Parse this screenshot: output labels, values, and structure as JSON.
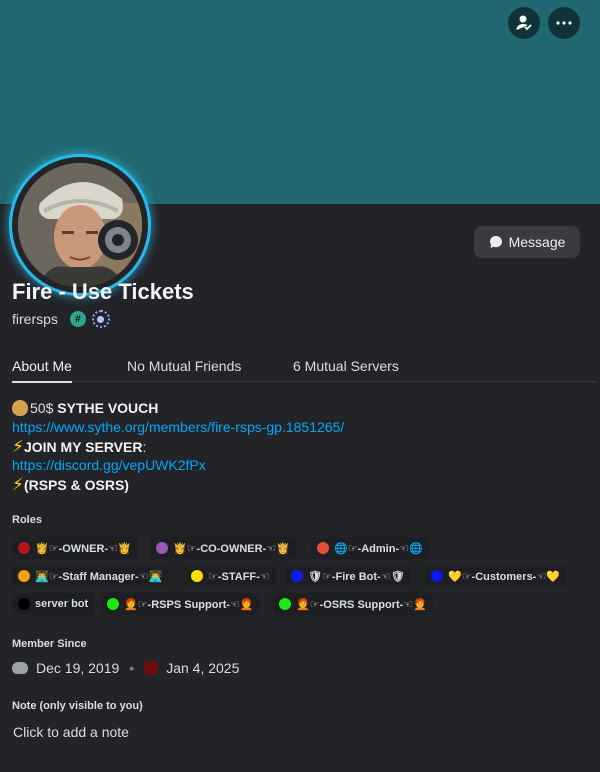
{
  "header": {
    "banner_color": "#216870",
    "add_friend_icon": "add-friend-icon",
    "more_icon": "more-options-icon"
  },
  "profile": {
    "display_name": "Fire - Use Tickets",
    "username": "firersps",
    "badge_hash": "#",
    "status": "offline",
    "message_button": "Message"
  },
  "tabs": [
    "About Me",
    "No Mutual Friends",
    "6 Mutual Servers"
  ],
  "about": {
    "line1_amount": "50$",
    "line1_text": "SYTHE VOUCH",
    "line2_link": "https://www.sythe.org/members/fire-rsps-gp.1851265/",
    "line3_text": "JOIN MY SERVER",
    "line3_colon": ":",
    "line4_link": "https://discord.gg/vepUWK2fPx",
    "line5_text": "(RSPS & OSRS)"
  },
  "roles_title": "Roles",
  "roles": [
    {
      "name": "👸☞-OWNER-☜👸",
      "color": "#b3171d"
    },
    {
      "name": "👸☞-CO-OWNER-☜👸",
      "color": "#9b59b6"
    },
    {
      "name": "🌐☞-Admin-☜🌐",
      "color": "#e74c3c"
    },
    {
      "name": "👨‍💻☞-Staff Manager-☜👨‍💻",
      "color": "#f1a30f"
    },
    {
      "name": "☞-STAFF-☜",
      "color": "#ffe000"
    },
    {
      "name": "🛡☞-Fire Bot-☜🛡",
      "color": "#0b1cf0"
    },
    {
      "name": "💛☞-Customers-☜💛",
      "color": "#0b1cf0"
    },
    {
      "name": "server bot",
      "color": "#000000"
    },
    {
      "name": "🧑‍🦰☞-RSPS Support-☜🧑‍🦰",
      "color": "#1ee814"
    },
    {
      "name": "🧑‍🦰☞-OSRS Support-☜🧑‍🦰",
      "color": "#1ee814"
    }
  ],
  "member_since": {
    "title": "Member Since",
    "discord_date": "Dec 19, 2019",
    "separator": "•",
    "server_date": "Jan 4, 2025"
  },
  "note": {
    "title": "Note (only visible to you)",
    "placeholder": "Click to add a note"
  }
}
